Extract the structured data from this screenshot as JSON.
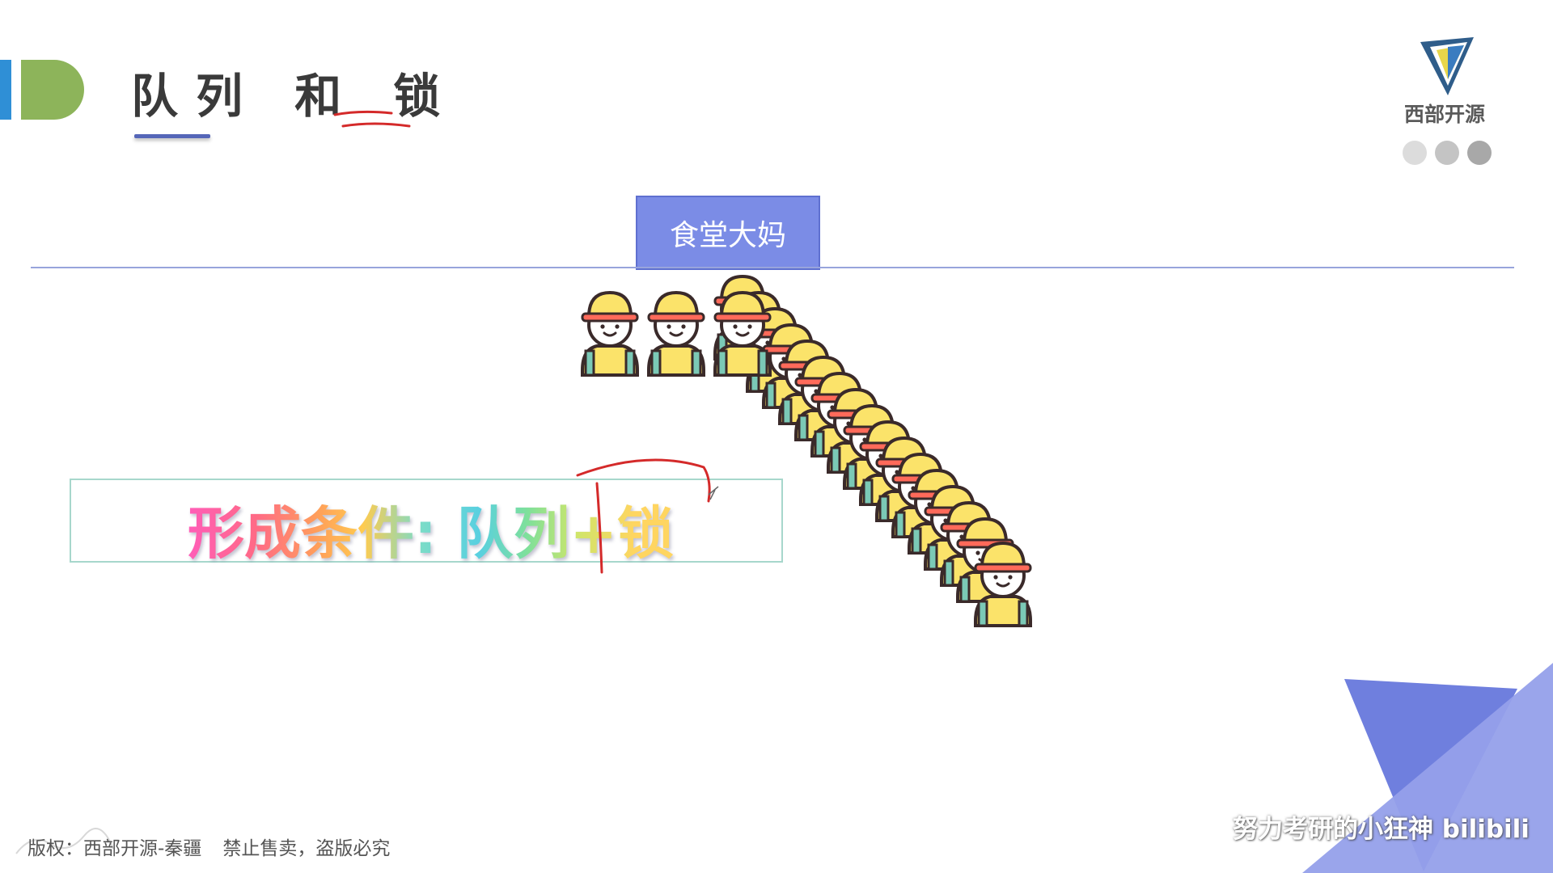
{
  "slide": {
    "title": "队列 和 锁",
    "queue_server_label": "食堂大妈",
    "condition_text": "形成条件: 队列+锁"
  },
  "branding": {
    "logo_text": "西部开源",
    "logo_icon": "triangle-v-logo-icon",
    "dots": [
      "#dcdcdc",
      "#c4c4c4",
      "#a8a8a8"
    ]
  },
  "footer": {
    "copyright": "版权：西部开源-秦疆",
    "notice": "禁止售卖，盗版必究"
  },
  "watermark": {
    "text": "努力考研的小狂神 bilibili"
  },
  "colors": {
    "accent_blue": "#7b8ce6",
    "badge_green": "#8db45a",
    "badge_blue": "#2f8fd6",
    "annotation_red": "#d42a2a"
  },
  "queue": {
    "person_icon": "student-yellow-hat-icon",
    "front_row_people": 3,
    "diagonal_people": 17
  }
}
